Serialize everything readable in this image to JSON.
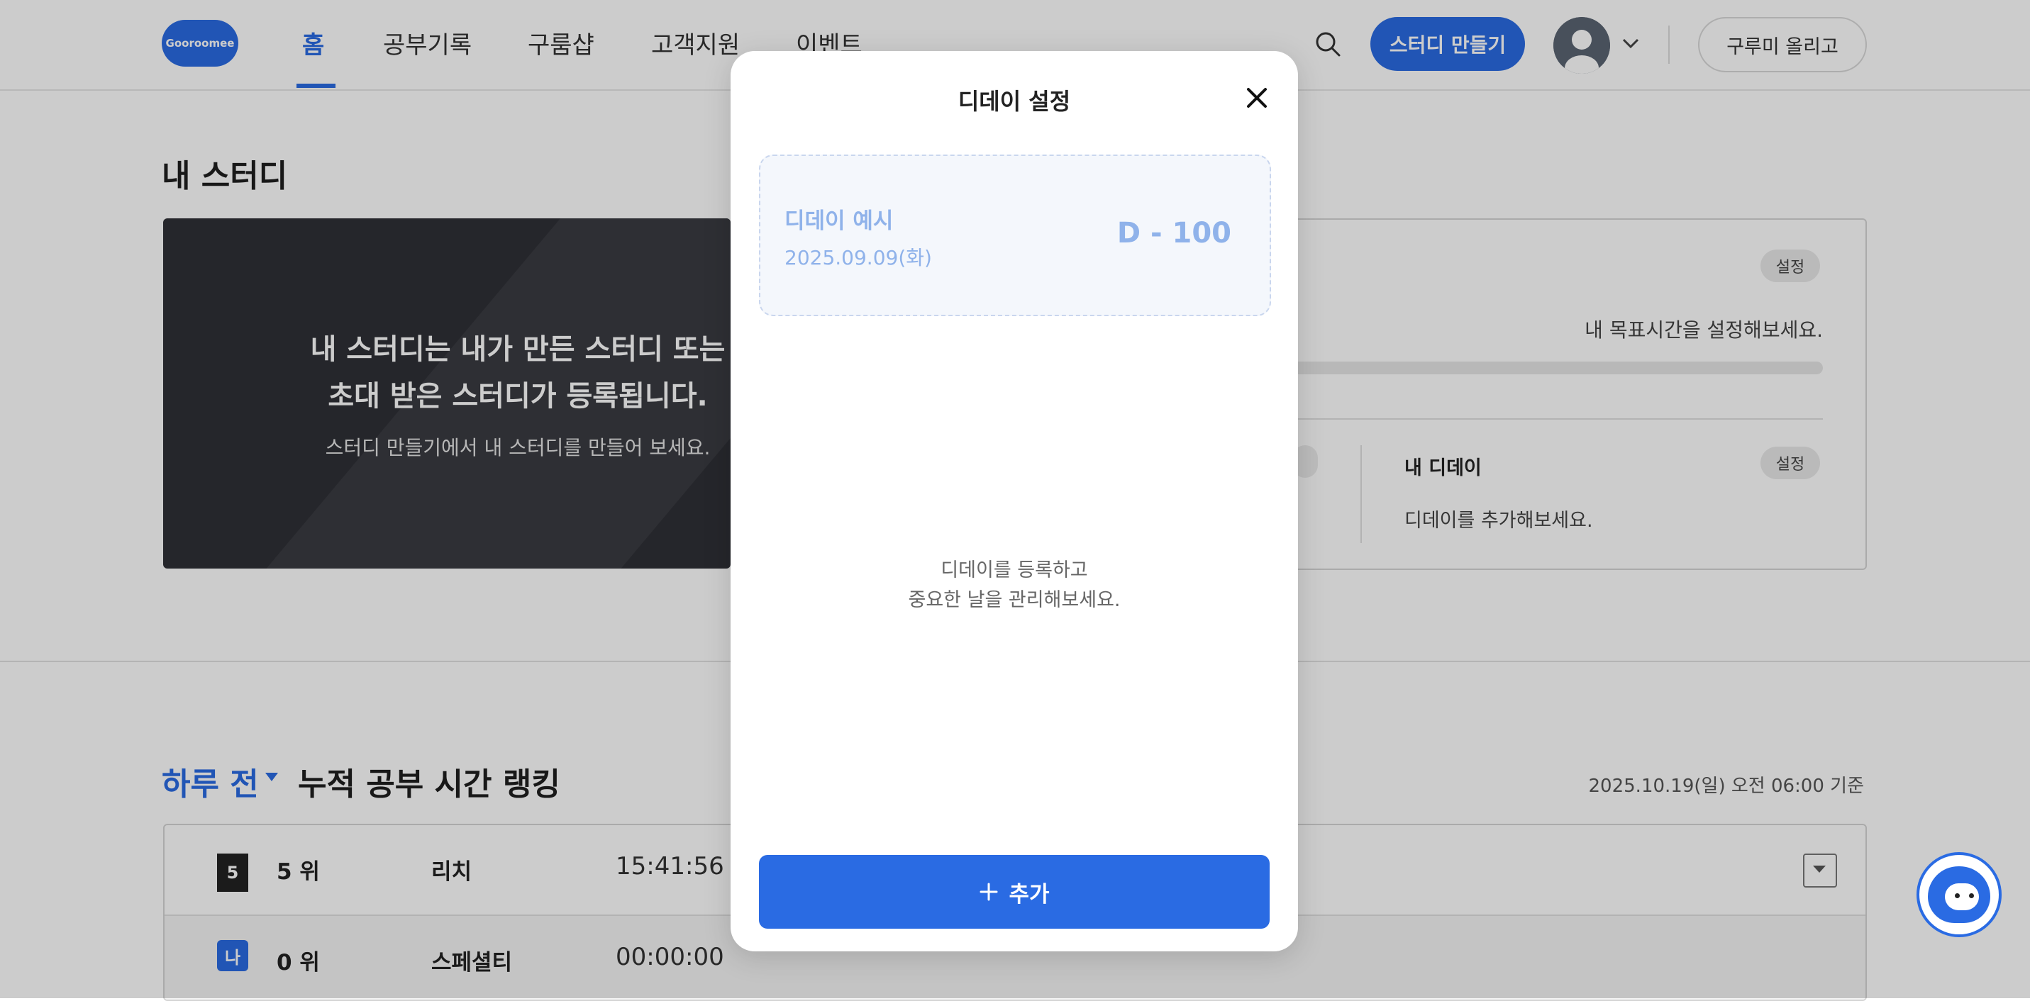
{
  "header": {
    "logo_text": "Gooroomee",
    "nav": [
      {
        "label": "홈",
        "active": true
      },
      {
        "label": "공부기록",
        "active": false
      },
      {
        "label": "구룸샵",
        "active": false
      },
      {
        "label": "고객지원",
        "active": false
      },
      {
        "label": "이벤트",
        "active": false
      }
    ],
    "create_button": "스터디 만들기",
    "upload_button": "구루미 올리고"
  },
  "my_study": {
    "title": "내 스터디",
    "dark_card": {
      "line1": "내 스터디는 내가 만든 스터디 또는",
      "line2": "초대 받은 스터디가 등록됩니다.",
      "sub": "스터디 만들기에서 내 스터디를 만들어 보세요."
    },
    "goal_card": {
      "setting_label": "설정",
      "goal_text": "내 목표시간을 설정해보세요.",
      "dday_title": "내 디데이",
      "dday_setting_label": "설정",
      "dday_text": "디데이를 추가해보세요."
    }
  },
  "ranking": {
    "period": "하루 전",
    "title": "누적 공부 시간 랭킹",
    "as_of": "2025.10.19(일) 오전 06:00 기준",
    "rows": [
      {
        "badge": "5",
        "rank": "5 위",
        "name": "리치",
        "time": "15:41:56"
      },
      {
        "badge": "나",
        "rank": "0 위",
        "name": "스페셜티",
        "time": "00:00:00"
      }
    ]
  },
  "modal": {
    "title": "디데이 설정",
    "example": {
      "title": "디데이 예시",
      "date": "2025.09.09(화)",
      "dday": "D - 100"
    },
    "empty_line1": "디데이를 등록하고",
    "empty_line2": "중요한 날을 관리해보세요.",
    "add_label": "추가"
  },
  "colors": {
    "accent": "#2a6be3",
    "example_text": "#8fb2ea",
    "dark_card": "#2f3036"
  },
  "icons": {
    "search": "search-icon",
    "close": "close-icon",
    "plus": "plus-icon",
    "chevron": "chevron-down-icon",
    "chatbot": "chatbot-icon"
  }
}
